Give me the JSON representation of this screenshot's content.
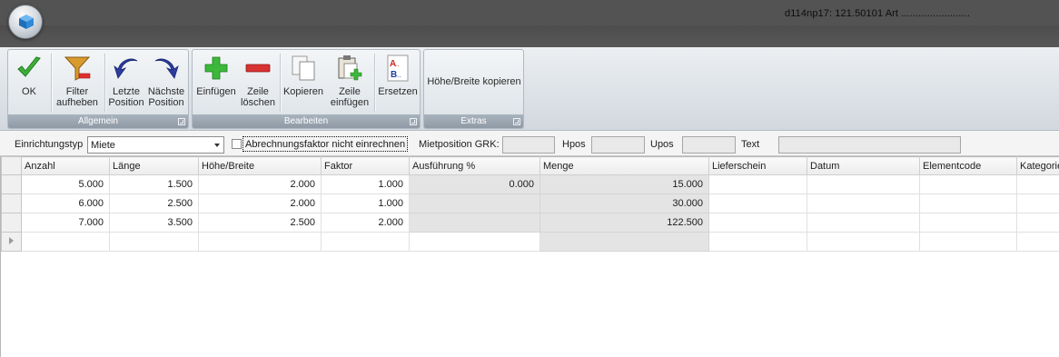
{
  "window": {
    "title": "d114np17: 121.50101 Art ........................"
  },
  "ribbon": {
    "groups": [
      {
        "caption": "Allgemein",
        "buttons": [
          {
            "label": "OK",
            "icon": "checkmark-icon"
          },
          {
            "label": "Filter\naufheben",
            "icon": "filter-clear-icon"
          },
          {
            "label": "Letzte\nPosition",
            "icon": "arrow-back-icon"
          },
          {
            "label": "Nächste\nPosition",
            "icon": "arrow-forward-icon"
          }
        ]
      },
      {
        "caption": "Bearbeiten",
        "buttons": [
          {
            "label": "Einfügen",
            "icon": "plus-icon"
          },
          {
            "label": "Zeile\nlöschen",
            "icon": "minus-icon"
          },
          {
            "label": "Kopieren",
            "icon": "copy-icon"
          },
          {
            "label": "Zeile\neinfügen",
            "icon": "paste-row-icon"
          },
          {
            "label": "Ersetzen",
            "icon": "replace-icon"
          }
        ]
      },
      {
        "caption": "Extras",
        "buttons": [
          {
            "label": "Höhe/Breite kopieren",
            "icon": ""
          }
        ]
      }
    ]
  },
  "filterbar": {
    "einrichtungstyp_label": "Einrichtungstyp",
    "einrichtungstyp_value": "Miete",
    "abrechnungsfaktor_label": "Abrechnungsfaktor nicht einrechnen",
    "abrechnungsfaktor_checked": false,
    "mietposition_label": "Mietposition GRK:",
    "mietposition_value": "",
    "hpos_label": "Hpos",
    "hpos_value": "",
    "upos_label": "Upos",
    "upos_value": "",
    "text_label": "Text",
    "text_value": ""
  },
  "grid": {
    "columns": [
      "Anzahl",
      "Länge",
      "Höhe/Breite",
      "Faktor",
      "Ausführung %",
      "Menge",
      "Lieferschein",
      "Datum",
      "Elementcode",
      "Kategorie"
    ],
    "rows": [
      [
        "5.000",
        "1.500",
        "2.000",
        "1.000",
        "0.000",
        "15.000",
        "",
        "",
        "",
        ""
      ],
      [
        "6.000",
        "2.500",
        "2.000",
        "1.000",
        "",
        "30.000",
        "",
        "",
        "",
        ""
      ],
      [
        "7.000",
        "3.500",
        "2.500",
        "2.000",
        "",
        "122.500",
        "",
        "",
        "",
        ""
      ]
    ]
  },
  "colors": {
    "titlebar": "#535353",
    "ribbon_caption": "#99a4af",
    "readonly_cell": "#e4e4e4"
  }
}
